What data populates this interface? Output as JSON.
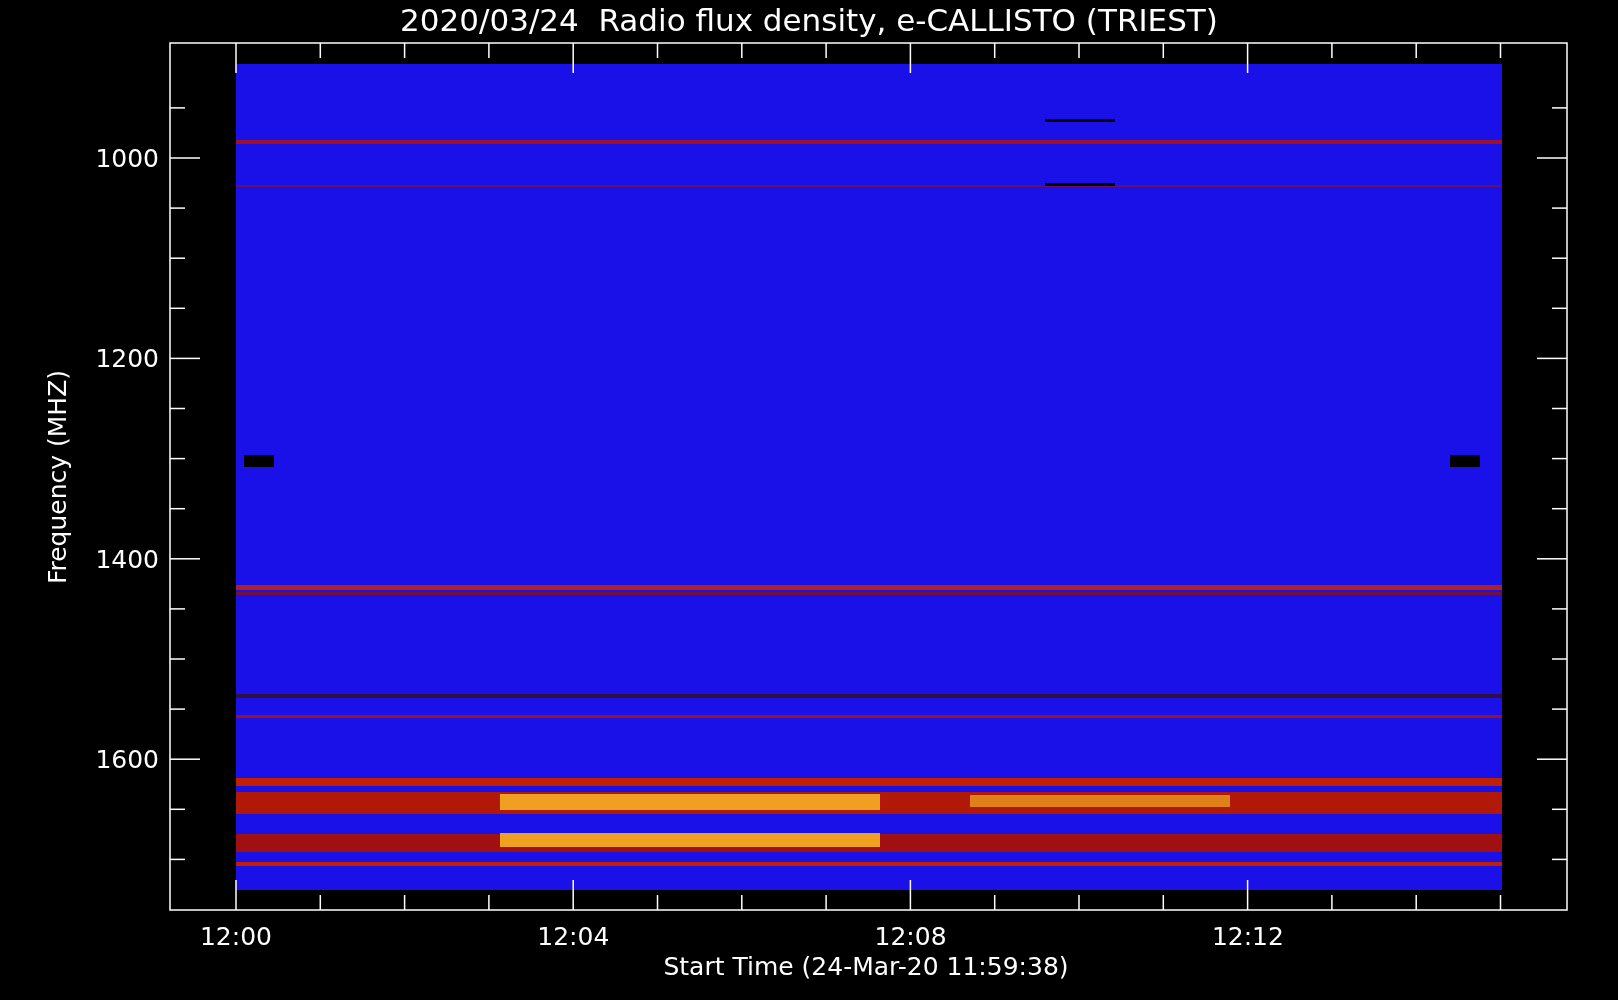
{
  "title": "2020/03/24  Radio flux density, e-CALLISTO (TRIEST)",
  "y_axis": {
    "label": "Frequency (MHZ)",
    "ticks": [
      "1000",
      "1200",
      "1400",
      "1600"
    ]
  },
  "x_axis": {
    "label": "Start Time (24-Mar-20 11:59:38)",
    "ticks": [
      "12:00",
      "12:04",
      "12:08",
      "12:12"
    ]
  }
}
